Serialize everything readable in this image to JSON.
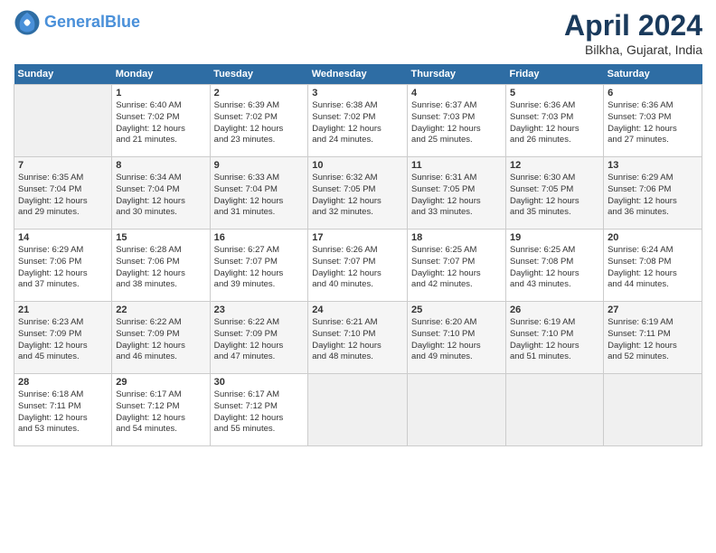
{
  "header": {
    "logo_line1": "General",
    "logo_line2": "Blue",
    "month": "April 2024",
    "location": "Bilkha, Gujarat, India"
  },
  "days_of_week": [
    "Sunday",
    "Monday",
    "Tuesday",
    "Wednesday",
    "Thursday",
    "Friday",
    "Saturday"
  ],
  "weeks": [
    [
      {
        "day": "",
        "info": ""
      },
      {
        "day": "1",
        "info": "Sunrise: 6:40 AM\nSunset: 7:02 PM\nDaylight: 12 hours\nand 21 minutes."
      },
      {
        "day": "2",
        "info": "Sunrise: 6:39 AM\nSunset: 7:02 PM\nDaylight: 12 hours\nand 23 minutes."
      },
      {
        "day": "3",
        "info": "Sunrise: 6:38 AM\nSunset: 7:02 PM\nDaylight: 12 hours\nand 24 minutes."
      },
      {
        "day": "4",
        "info": "Sunrise: 6:37 AM\nSunset: 7:03 PM\nDaylight: 12 hours\nand 25 minutes."
      },
      {
        "day": "5",
        "info": "Sunrise: 6:36 AM\nSunset: 7:03 PM\nDaylight: 12 hours\nand 26 minutes."
      },
      {
        "day": "6",
        "info": "Sunrise: 6:36 AM\nSunset: 7:03 PM\nDaylight: 12 hours\nand 27 minutes."
      }
    ],
    [
      {
        "day": "7",
        "info": "Sunrise: 6:35 AM\nSunset: 7:04 PM\nDaylight: 12 hours\nand 29 minutes."
      },
      {
        "day": "8",
        "info": "Sunrise: 6:34 AM\nSunset: 7:04 PM\nDaylight: 12 hours\nand 30 minutes."
      },
      {
        "day": "9",
        "info": "Sunrise: 6:33 AM\nSunset: 7:04 PM\nDaylight: 12 hours\nand 31 minutes."
      },
      {
        "day": "10",
        "info": "Sunrise: 6:32 AM\nSunset: 7:05 PM\nDaylight: 12 hours\nand 32 minutes."
      },
      {
        "day": "11",
        "info": "Sunrise: 6:31 AM\nSunset: 7:05 PM\nDaylight: 12 hours\nand 33 minutes."
      },
      {
        "day": "12",
        "info": "Sunrise: 6:30 AM\nSunset: 7:05 PM\nDaylight: 12 hours\nand 35 minutes."
      },
      {
        "day": "13",
        "info": "Sunrise: 6:29 AM\nSunset: 7:06 PM\nDaylight: 12 hours\nand 36 minutes."
      }
    ],
    [
      {
        "day": "14",
        "info": "Sunrise: 6:29 AM\nSunset: 7:06 PM\nDaylight: 12 hours\nand 37 minutes."
      },
      {
        "day": "15",
        "info": "Sunrise: 6:28 AM\nSunset: 7:06 PM\nDaylight: 12 hours\nand 38 minutes."
      },
      {
        "day": "16",
        "info": "Sunrise: 6:27 AM\nSunset: 7:07 PM\nDaylight: 12 hours\nand 39 minutes."
      },
      {
        "day": "17",
        "info": "Sunrise: 6:26 AM\nSunset: 7:07 PM\nDaylight: 12 hours\nand 40 minutes."
      },
      {
        "day": "18",
        "info": "Sunrise: 6:25 AM\nSunset: 7:07 PM\nDaylight: 12 hours\nand 42 minutes."
      },
      {
        "day": "19",
        "info": "Sunrise: 6:25 AM\nSunset: 7:08 PM\nDaylight: 12 hours\nand 43 minutes."
      },
      {
        "day": "20",
        "info": "Sunrise: 6:24 AM\nSunset: 7:08 PM\nDaylight: 12 hours\nand 44 minutes."
      }
    ],
    [
      {
        "day": "21",
        "info": "Sunrise: 6:23 AM\nSunset: 7:09 PM\nDaylight: 12 hours\nand 45 minutes."
      },
      {
        "day": "22",
        "info": "Sunrise: 6:22 AM\nSunset: 7:09 PM\nDaylight: 12 hours\nand 46 minutes."
      },
      {
        "day": "23",
        "info": "Sunrise: 6:22 AM\nSunset: 7:09 PM\nDaylight: 12 hours\nand 47 minutes."
      },
      {
        "day": "24",
        "info": "Sunrise: 6:21 AM\nSunset: 7:10 PM\nDaylight: 12 hours\nand 48 minutes."
      },
      {
        "day": "25",
        "info": "Sunrise: 6:20 AM\nSunset: 7:10 PM\nDaylight: 12 hours\nand 49 minutes."
      },
      {
        "day": "26",
        "info": "Sunrise: 6:19 AM\nSunset: 7:10 PM\nDaylight: 12 hours\nand 51 minutes."
      },
      {
        "day": "27",
        "info": "Sunrise: 6:19 AM\nSunset: 7:11 PM\nDaylight: 12 hours\nand 52 minutes."
      }
    ],
    [
      {
        "day": "28",
        "info": "Sunrise: 6:18 AM\nSunset: 7:11 PM\nDaylight: 12 hours\nand 53 minutes."
      },
      {
        "day": "29",
        "info": "Sunrise: 6:17 AM\nSunset: 7:12 PM\nDaylight: 12 hours\nand 54 minutes."
      },
      {
        "day": "30",
        "info": "Sunrise: 6:17 AM\nSunset: 7:12 PM\nDaylight: 12 hours\nand 55 minutes."
      },
      {
        "day": "",
        "info": ""
      },
      {
        "day": "",
        "info": ""
      },
      {
        "day": "",
        "info": ""
      },
      {
        "day": "",
        "info": ""
      }
    ]
  ]
}
